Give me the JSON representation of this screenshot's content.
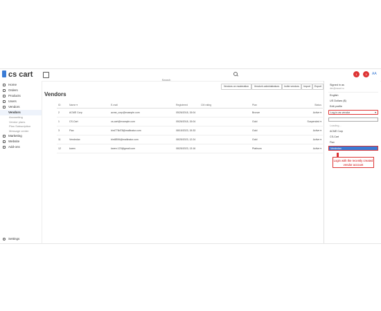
{
  "app": {
    "logo": "cs cart"
  },
  "header": {
    "search_placeholder": "Search",
    "notif_count_1": "1",
    "notif_count_2": "3",
    "avatar": "AA"
  },
  "sidebar": {
    "items": [
      {
        "label": "Home",
        "icon": "home-icon"
      },
      {
        "label": "Orders",
        "icon": "orders-icon"
      },
      {
        "label": "Products",
        "icon": "products-icon"
      },
      {
        "label": "Users",
        "icon": "users-icon"
      },
      {
        "label": "Vendors",
        "icon": "vendors-icon"
      }
    ],
    "vendors_sub": [
      "Vendors",
      "Accounting",
      "Vendor plans",
      "Plan Subscription",
      "Message center"
    ],
    "items2": [
      {
        "label": "Marketing",
        "icon": "marketing-icon"
      },
      {
        "label": "Website",
        "icon": "website-icon"
      },
      {
        "label": "Add-ons",
        "icon": "addons-icon"
      }
    ],
    "settings": "Settings"
  },
  "main": {
    "title": "Vendors",
    "toolbar": [
      "Vendors on moderation",
      "Vendor's administrators",
      "Invite vendors",
      "Import",
      "Export"
    ]
  },
  "table": {
    "headers": [
      "ID",
      "Name ▾",
      "E-mail",
      "Registered",
      "CM rating",
      "Plan",
      "Status"
    ],
    "rows": [
      {
        "id": "2",
        "name": "ACME Corp",
        "email": "acme_corp@example.com",
        "registered": "05/26/2018, 15:04",
        "plan": "Bronze",
        "status": "Active ▾"
      },
      {
        "id": "1",
        "name": "CS-Cart",
        "email": "cs-cart@example.com",
        "registered": "05/26/2018, 15:04",
        "plan": "Gold",
        "status": "Suspended ▾"
      },
      {
        "id": "3",
        "name": "Flax",
        "email": "bird778d78@mailinator.com",
        "registered": "08/15/2023, 15:33",
        "plan": "Gold",
        "status": "Active ▾"
      },
      {
        "id": "11",
        "name": "Vendrolax",
        "email": "bird8594@mailinator.com",
        "registered": "08/25/2023, 12:24",
        "plan": "Gold",
        "status": "Active ▾"
      },
      {
        "id": "12",
        "name": "karen",
        "email": "karen.123@gmail.com",
        "registered": "08/25/2023, 13:16",
        "plan": "Platinum",
        "status": "Active ▾"
      }
    ]
  },
  "panel": {
    "signed_in": "Signed in as",
    "signed_in_email": "dev@cscart.ru",
    "language": "English",
    "currency": "US Dollars ($)",
    "edit_profile": "Edit profile",
    "dropdown_label": "Log in as vendor",
    "loading": "Loading...",
    "options": [
      "ACME Corp",
      "CS-Cart",
      "Flax",
      "Vendrolax"
    ],
    "selected": "Vendrolax",
    "callout": "Login with the recently created vendor account"
  }
}
